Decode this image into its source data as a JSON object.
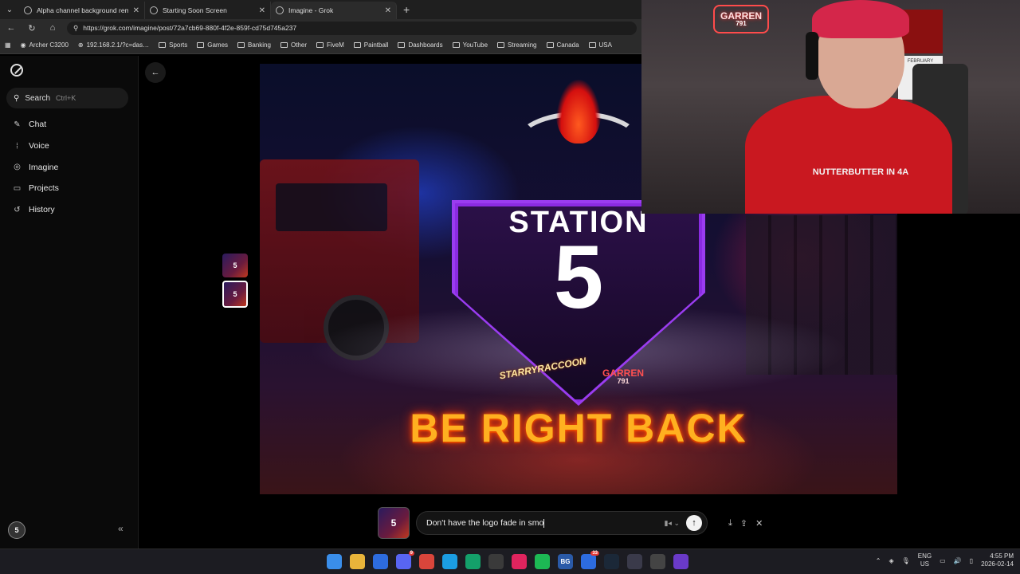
{
  "browser": {
    "tabs": [
      {
        "label": "Alpha channel background remo…",
        "active": false
      },
      {
        "label": "Starting Soon Screen",
        "active": false
      },
      {
        "label": "Imagine - Grok",
        "active": true
      }
    ],
    "url": "https://grok.com/imagine/post/72a7cb69-880f-4f2e-859f-cd75d745a237",
    "bookmarks": [
      "Archer C3200",
      "192.168.2.1/?c=das…",
      "Sports",
      "Games",
      "Banking",
      "Other",
      "FiveM",
      "Paintball",
      "Dashboards",
      "YouTube",
      "Streaming",
      "Canada",
      "USA"
    ]
  },
  "sidebar": {
    "search_label": "Search",
    "search_shortcut": "Ctrl+K",
    "items": [
      {
        "label": "Chat",
        "icon": "chat-edit-icon"
      },
      {
        "label": "Voice",
        "icon": "waveform-icon"
      },
      {
        "label": "Imagine",
        "icon": "image-icon"
      },
      {
        "label": "Projects",
        "icon": "folder-icon"
      },
      {
        "label": "History",
        "icon": "history-icon"
      }
    ],
    "avatar_text": "5"
  },
  "main": {
    "thumbnails": [
      {
        "text": "5"
      },
      {
        "text": "5"
      }
    ],
    "image": {
      "station_text": "STATION",
      "number_text": "5",
      "left_badge": "STARRYRACCOON",
      "right_badge": "GARREN",
      "right_badge_sub": "791",
      "headline": "BE RIGHT BACK"
    },
    "prompt": {
      "thumb_text": "5",
      "value": "Don't have the logo fade in smo",
      "mode_label": "▮◂ ⌄"
    }
  },
  "webcam": {
    "sign_text": "GARREN",
    "sign_sub": "791",
    "calendar_label": "FEBRUARY",
    "shirt_text": "NUTTERBUTTER IN 4A"
  },
  "taskbar": {
    "icons": [
      {
        "name": "windows-start-icon",
        "glyph": "",
        "color": "#3a8eea"
      },
      {
        "name": "file-explorer-icon",
        "glyph": "",
        "color": "#e8b43a"
      },
      {
        "name": "store-icon",
        "glyph": "",
        "color": "#2d6cdf"
      },
      {
        "name": "discord-icon",
        "glyph": "",
        "color": "#5865f2",
        "badge": "9"
      },
      {
        "name": "chrome-icon",
        "glyph": "",
        "color": "#d9453b"
      },
      {
        "name": "edge-icon",
        "glyph": "",
        "color": "#1b9de2"
      },
      {
        "name": "green-app-icon",
        "glyph": "",
        "color": "#14a06a"
      },
      {
        "name": "obs-icon",
        "glyph": "",
        "color": "#3a3a3a"
      },
      {
        "name": "red-app-icon",
        "glyph": "",
        "color": "#e0245e"
      },
      {
        "name": "spotify-icon",
        "glyph": "",
        "color": "#1db954"
      },
      {
        "name": "bg-app-icon",
        "glyph": "BG",
        "color": "#2a5aa8"
      },
      {
        "name": "mail-icon",
        "glyph": "",
        "color": "#2d6cdf",
        "badge": "33"
      },
      {
        "name": "steam-icon",
        "glyph": "",
        "color": "#1b2838"
      },
      {
        "name": "arrow-app-icon",
        "glyph": "",
        "color": "#3a3a4a"
      },
      {
        "name": "media-app-icon",
        "glyph": "",
        "color": "#444"
      },
      {
        "name": "grid-app-icon",
        "glyph": "",
        "color": "#6a3ac8"
      }
    ],
    "lang": "ENG",
    "region": "US",
    "time": "4:55 PM",
    "date": "2026-02-14"
  }
}
